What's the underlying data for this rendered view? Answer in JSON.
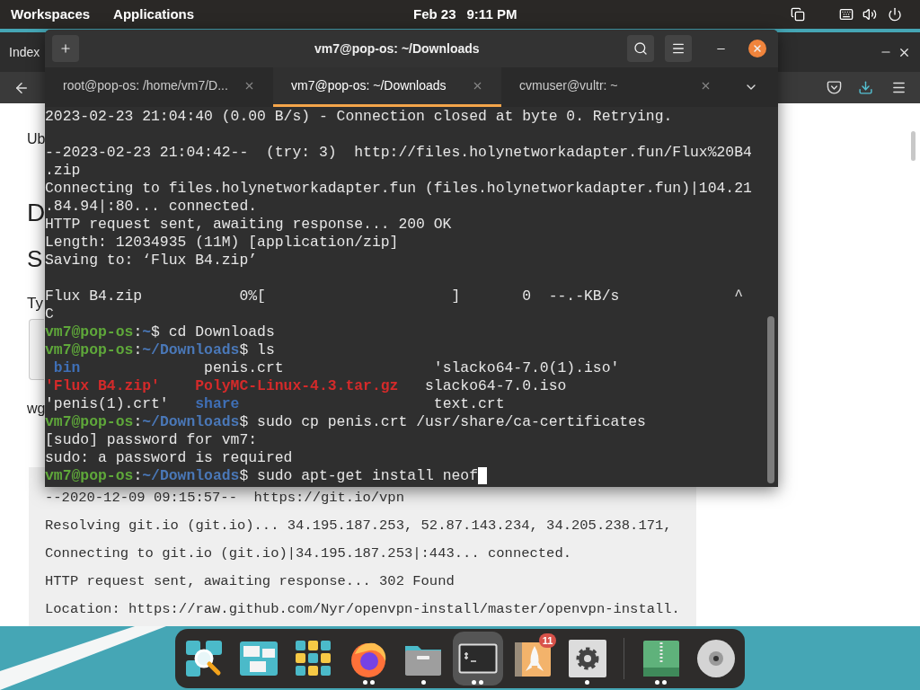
{
  "top_bar": {
    "menus": [
      "Workspaces",
      "Applications"
    ],
    "date": "Feb 23",
    "time": "9:11 PM"
  },
  "browser": {
    "tab_title": "Index",
    "page": [
      {
        "kind": "paragraph",
        "text": "Ub"
      },
      {
        "kind": "heading",
        "text": "D"
      },
      {
        "kind": "subheading",
        "text": "S"
      },
      {
        "kind": "label",
        "text": "Ty"
      },
      {
        "kind": "field"
      },
      {
        "kind": "paragraph",
        "text": "wg"
      }
    ],
    "code_lines": [
      "--2020-12-09 09:15:57--  https://git.io/vpn",
      "Resolving git.io (git.io)... 34.195.187.253, 52.87.143.234, 34.205.238.171,",
      "Connecting to git.io (git.io)|34.195.187.253|:443... connected.",
      "HTTP request sent, awaiting response... 302 Found",
      "Location: https://raw.github.com/Nyr/openvpn-install/master/openvpn-install."
    ]
  },
  "terminal": {
    "title": "vm7@pop-os: ~/Downloads",
    "tabs": [
      {
        "label": "root@pop-os: /home/vm7/D...",
        "selected": false
      },
      {
        "label": "vm7@pop-os: ~/Downloads",
        "selected": true
      },
      {
        "label": "cvmuser@vultr: ~",
        "selected": false
      }
    ],
    "lines": [
      {
        "kind": "text",
        "segments": [
          {
            "kind": "plain",
            "text": "2023-02-23 21:04:40 (0.00 B/s) - Connection closed at byte 0. Retrying."
          }
        ]
      },
      {
        "kind": "blank"
      },
      {
        "kind": "text",
        "segments": [
          {
            "kind": "plain",
            "text": "--2023-02-23 21:04:42--  (try: 3)  http://files.holynetworkadapter.fun/Flux%20B4"
          }
        ]
      },
      {
        "kind": "text",
        "segments": [
          {
            "kind": "plain",
            "text": ".zip"
          }
        ]
      },
      {
        "kind": "text",
        "segments": [
          {
            "kind": "plain",
            "text": "Connecting to files.holynetworkadapter.fun (files.holynetworkadapter.fun)|104.21"
          }
        ]
      },
      {
        "kind": "text",
        "segments": [
          {
            "kind": "plain",
            "text": ".84.94|:80... connected."
          }
        ]
      },
      {
        "kind": "text",
        "segments": [
          {
            "kind": "plain",
            "text": "HTTP request sent, awaiting response... 200 OK"
          }
        ]
      },
      {
        "kind": "text",
        "segments": [
          {
            "kind": "plain",
            "text": "Length: 12034935 (11M) [application/zip]"
          }
        ]
      },
      {
        "kind": "text",
        "segments": [
          {
            "kind": "plain",
            "text": "Saving to: ‘Flux B4.zip’"
          }
        ]
      },
      {
        "kind": "blank"
      },
      {
        "kind": "text",
        "segments": [
          {
            "kind": "plain",
            "text": "Flux B4.zip           0%[                     ]       0  --.-KB/s             ^"
          }
        ]
      },
      {
        "kind": "text",
        "segments": [
          {
            "kind": "plain",
            "text": "C"
          }
        ]
      },
      {
        "kind": "text",
        "segments": [
          {
            "kind": "user",
            "text": "vm7@pop-os"
          },
          {
            "kind": "plain",
            "text": ":"
          },
          {
            "kind": "path",
            "text": "~"
          },
          {
            "kind": "plain",
            "text": "$ cd Downloads"
          }
        ]
      },
      {
        "kind": "text",
        "segments": [
          {
            "kind": "user",
            "text": "vm7@pop-os"
          },
          {
            "kind": "plain",
            "text": ":"
          },
          {
            "kind": "path",
            "text": "~/Downloads"
          },
          {
            "kind": "plain",
            "text": "$ ls"
          }
        ]
      },
      {
        "kind": "text",
        "segments": [
          {
            "kind": "dir",
            "text": " bin"
          },
          {
            "kind": "plain",
            "text": "              penis.crt                 'slacko64-7.0(1).iso'"
          }
        ]
      },
      {
        "kind": "text",
        "segments": [
          {
            "kind": "archive",
            "text": "'Flux B4.zip'    "
          },
          {
            "kind": "archive",
            "text": "PolyMC-Linux-4.3.tar.gz"
          },
          {
            "kind": "plain",
            "text": "   slacko64-7.0.iso"
          }
        ]
      },
      {
        "kind": "text",
        "segments": [
          {
            "kind": "plain",
            "text": "'penis(1).crt'   "
          },
          {
            "kind": "dir",
            "text": "share"
          },
          {
            "kind": "plain",
            "text": "                      text.crt"
          }
        ]
      },
      {
        "kind": "text",
        "segments": [
          {
            "kind": "user",
            "text": "vm7@pop-os"
          },
          {
            "kind": "plain",
            "text": ":"
          },
          {
            "kind": "path",
            "text": "~/Downloads"
          },
          {
            "kind": "plain",
            "text": "$ sudo cp penis.crt /usr/share/ca-certificates"
          }
        ]
      },
      {
        "kind": "text",
        "segments": [
          {
            "kind": "plain",
            "text": "[sudo] password for vm7:"
          }
        ]
      },
      {
        "kind": "text",
        "segments": [
          {
            "kind": "plain",
            "text": "sudo: a password is required"
          }
        ]
      },
      {
        "kind": "prompt",
        "segments": [
          {
            "kind": "user",
            "text": "vm7@pop-os"
          },
          {
            "kind": "plain",
            "text": ":"
          },
          {
            "kind": "path",
            "text": "~/Downloads"
          },
          {
            "kind": "plain",
            "text": "$ sudo apt-get install neof"
          }
        ]
      }
    ]
  },
  "dock": {
    "items": [
      {
        "kind": "search",
        "running": false,
        "selected": false
      },
      {
        "kind": "workspaces",
        "running": false,
        "selected": false
      },
      {
        "kind": "apps",
        "running": false,
        "selected": false
      },
      {
        "kind": "firefox",
        "running": true,
        "multiple_windows": true,
        "selected": false
      },
      {
        "kind": "files",
        "running": true,
        "multiple_windows": false,
        "selected": false
      },
      {
        "kind": "terminal",
        "running": true,
        "multiple_windows": true,
        "selected": true
      },
      {
        "kind": "launcher",
        "running": false,
        "selected": false,
        "badge": "11"
      },
      {
        "kind": "settings",
        "running": true,
        "multiple_windows": false,
        "selected": false
      },
      {
        "kind": "separator"
      },
      {
        "kind": "archive",
        "running": true,
        "multiple_windows": true,
        "selected": false
      },
      {
        "kind": "disc",
        "running": false,
        "selected": false
      }
    ]
  }
}
